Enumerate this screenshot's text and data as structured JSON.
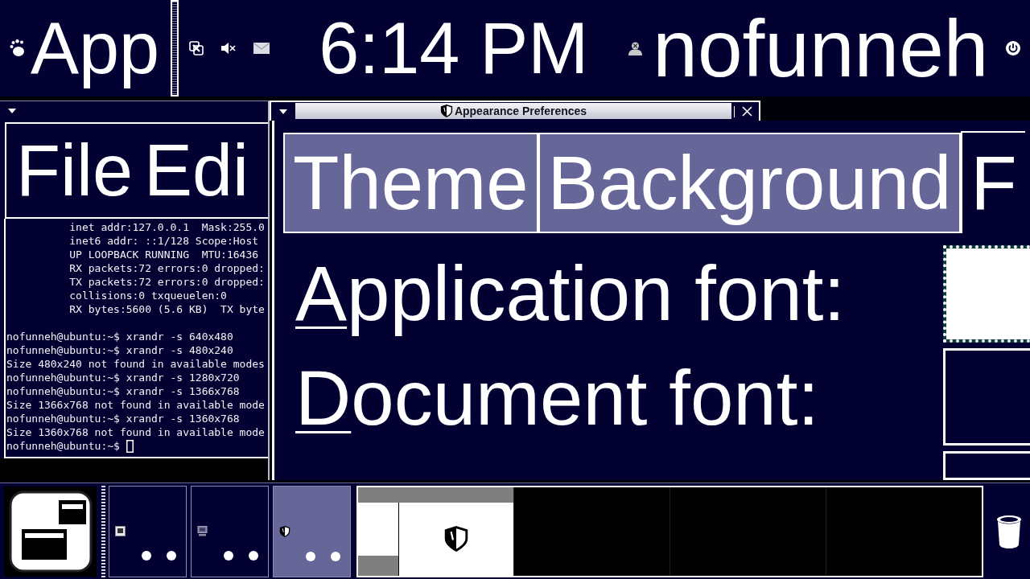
{
  "top_panel": {
    "menu_label": "App",
    "clock": "6:14 PM",
    "user": "nofunneh"
  },
  "terminal": {
    "menus": [
      "File",
      "Edi"
    ],
    "lines": [
      {
        "kind": "detail",
        "text": "inet addr:127.0.0.1  Mask:255.0"
      },
      {
        "kind": "detail",
        "text": "inet6 addr: ::1/128 Scope:Host"
      },
      {
        "kind": "detail",
        "text": "UP LOOPBACK RUNNING  MTU:16436"
      },
      {
        "kind": "detail",
        "text": "RX packets:72 errors:0 dropped:"
      },
      {
        "kind": "detail",
        "text": "TX packets:72 errors:0 dropped:"
      },
      {
        "kind": "detail",
        "text": "collisions:0 txqueuelen:0"
      },
      {
        "kind": "detail",
        "text": "RX bytes:5600 (5.6 KB)  TX byte"
      },
      {
        "kind": "blank"
      },
      {
        "kind": "command",
        "text": "nofunneh@ubuntu:~$ xrandr -s 640x480"
      },
      {
        "kind": "command",
        "text": "nofunneh@ubuntu:~$ xrandr -s 480x240"
      },
      {
        "kind": "output",
        "text": "Size 480x240 not found in available modes"
      },
      {
        "kind": "command",
        "text": "nofunneh@ubuntu:~$ xrandr -s 1280x720"
      },
      {
        "kind": "command",
        "text": "nofunneh@ubuntu:~$ xrandr -s 1366x768"
      },
      {
        "kind": "output",
        "text": "Size 1366x768 not found in available mode"
      },
      {
        "kind": "command",
        "text": "nofunneh@ubuntu:~$ xrandr -s 1360x768"
      },
      {
        "kind": "output",
        "text": "Size 1360x768 not found in available mode"
      },
      {
        "kind": "input",
        "text": "nofunneh@ubuntu:~$"
      }
    ]
  },
  "appearance_window": {
    "title": "Appearance Preferences",
    "tabs": [
      {
        "label": "Theme",
        "selected": false
      },
      {
        "label": "Background",
        "selected": false
      },
      {
        "label": "F",
        "selected": true
      }
    ],
    "font_rows": [
      {
        "label": "Application font:",
        "mnemonic": true
      },
      {
        "label": "Document font:",
        "mnemonic": true
      }
    ],
    "font_buttons": [
      {
        "focused": true
      },
      {
        "focused": false
      },
      {
        "focused": false
      }
    ]
  },
  "bottom_panel": {
    "window_buttons": [
      {
        "kind": "terminal",
        "selected": false
      },
      {
        "kind": "computer",
        "selected": false
      },
      {
        "kind": "appearance",
        "selected": true
      }
    ],
    "workspaces": [
      {
        "selected": true
      },
      {
        "selected": false
      },
      {
        "selected": false
      },
      {
        "selected": false
      }
    ]
  }
}
